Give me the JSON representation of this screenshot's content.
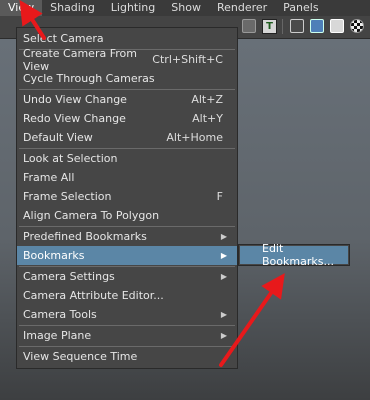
{
  "menubar": [
    "View",
    "Shading",
    "Lighting",
    "Show",
    "Renderer",
    "Panels"
  ],
  "menu": {
    "items": [
      {
        "label": "Select Camera",
        "shortcut": ""
      },
      {
        "label": "Create Camera From View",
        "shortcut": "Ctrl+Shift+C"
      },
      {
        "label": "Cycle Through Cameras",
        "shortcut": ""
      },
      {
        "label": "Undo View Change",
        "shortcut": "Alt+Z"
      },
      {
        "label": "Redo View Change",
        "shortcut": "Alt+Y"
      },
      {
        "label": "Default View",
        "shortcut": "Alt+Home"
      },
      {
        "label": "Look at Selection",
        "shortcut": ""
      },
      {
        "label": "Frame All",
        "shortcut": ""
      },
      {
        "label": "Frame Selection",
        "shortcut": "F"
      },
      {
        "label": "Align Camera To Polygon",
        "shortcut": ""
      },
      {
        "label": "Predefined Bookmarks",
        "shortcut": ""
      },
      {
        "label": "Bookmarks",
        "shortcut": ""
      },
      {
        "label": "Camera Settings",
        "shortcut": ""
      },
      {
        "label": "Camera Attribute Editor...",
        "shortcut": ""
      },
      {
        "label": "Camera Tools",
        "shortcut": ""
      },
      {
        "label": "Image Plane",
        "shortcut": ""
      },
      {
        "label": "View Sequence Time",
        "shortcut": ""
      }
    ],
    "submenu_item": "Edit Bookmarks..."
  },
  "toolbar": {
    "text_icon": "T"
  },
  "colors": {
    "highlight": "#5b86a6",
    "annotation": "#e8191b"
  }
}
